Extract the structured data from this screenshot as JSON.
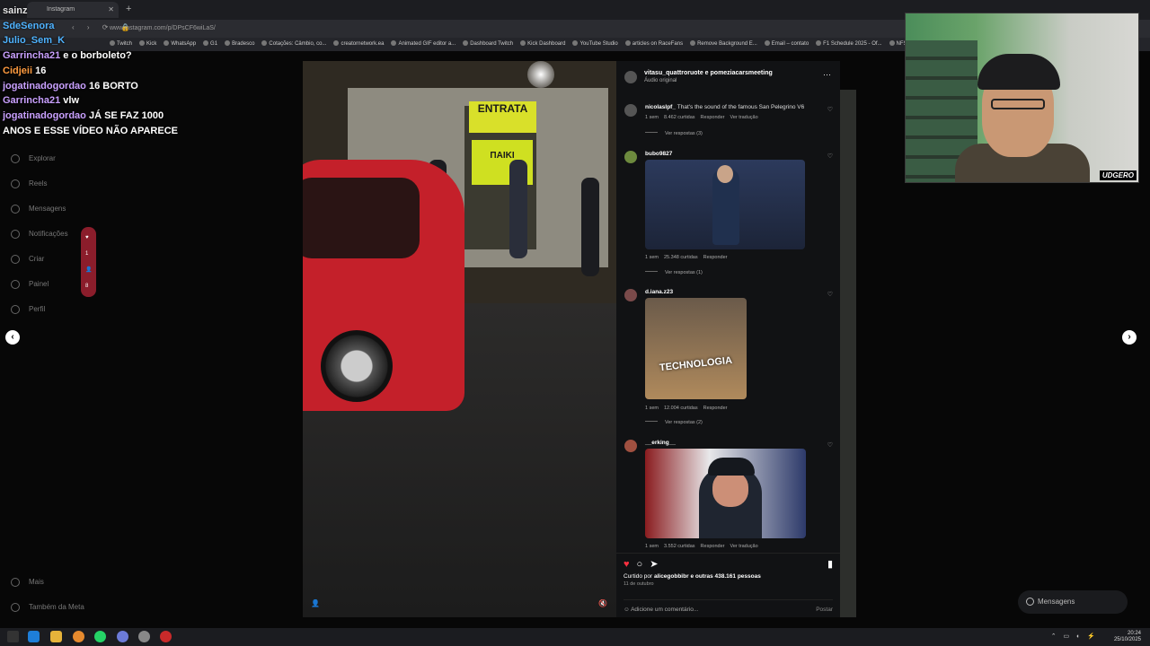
{
  "browser": {
    "tab_title": "Instagram",
    "url": "www.instagram.com/p/DPsCF6wiLaS/",
    "bookmarks": [
      "Twitch",
      "Kick",
      "WhatsApp",
      "G1",
      "Bradesco",
      "Cotações: Câmbio, co...",
      "creatornetwork.ea",
      "Animated GIF editor a...",
      "Dashboard Twitch",
      "Kick Dashboard",
      "YouTube Studio",
      "articles on RaceFans",
      "Remove Background E...",
      "Email – contato",
      "F1 Schedule 2025 - Of...",
      "NFS-e | Portal Contr..."
    ]
  },
  "chat": [
    {
      "user": "sainz",
      "text": "",
      "color": "#e6e6e6"
    },
    {
      "user": "SdeSenora",
      "text": "",
      "color": "#4fb3ff"
    },
    {
      "user": "Julio_Sem_K",
      "text": "",
      "color": "#4fb3ff"
    },
    {
      "user": "Garrincha21",
      "text": "e o borboleto?",
      "color": "#c9a0ff"
    },
    {
      "user": "Cidjeii",
      "text": "16",
      "color": "#ff9b3f"
    },
    {
      "user": "jogatinadogordao",
      "text": "16 BORTO",
      "color": "#c9a0ff"
    },
    {
      "user": "Garrincha21",
      "text": "vlw",
      "color": "#c9a0ff"
    },
    {
      "user": "jogatinadogordao",
      "text": "JÁ SE FAZ 1000",
      "color": "#c9a0ff"
    },
    {
      "user": "",
      "text": "ANOS E ESSE VÍDEO NÃO APARECE",
      "color": "#fff"
    }
  ],
  "sidenav": {
    "items": [
      {
        "label": "Explorar",
        "icon": "compass-icon"
      },
      {
        "label": "Reels",
        "icon": "reels-icon"
      },
      {
        "label": "Mensagens",
        "icon": "messenger-icon"
      },
      {
        "label": "Notificações",
        "icon": "heart-icon"
      },
      {
        "label": "Criar",
        "icon": "plus-icon"
      },
      {
        "label": "Painel",
        "icon": "dashboard-icon"
      },
      {
        "label": "Perfil",
        "icon": "profile-icon"
      }
    ],
    "notif_badge": "♥ 1  👤 8",
    "bottom": [
      {
        "label": "Mais",
        "icon": "menu-icon"
      },
      {
        "label": "Também da Meta",
        "icon": "meta-icon"
      }
    ]
  },
  "video": {
    "sign_top": "ENTRATA",
    "sign_brand": "ΠΑΙΚΙ"
  },
  "post": {
    "author": "vitasu_quattroruote e pomeziacarsmeeting",
    "audio": "Áudio original",
    "comments": [
      {
        "user": "nicolaslpf_",
        "text": "That's the sound of the famous San Pelegrino V6",
        "time": "1 sem",
        "likes": "8.462 curtidas",
        "reply": "Responder",
        "translate": "Ver tradução",
        "replies": "Ver respostas (3)"
      },
      {
        "user": "bubo9827",
        "text": "",
        "time": "1 sem",
        "likes": "25.348 curtidas",
        "reply": "Responder",
        "translate": "",
        "replies": "Ver respostas (1)"
      },
      {
        "user": "d.iana.z23",
        "text": "",
        "time": "1 sem",
        "likes": "12.004 curtidas",
        "reply": "Responder",
        "translate": "",
        "replies": "Ver respostas (2)",
        "gif_text": "TECHNOLOGIA"
      },
      {
        "user": "__erking__",
        "text": "",
        "time": "1 sem",
        "likes": "3.552 curtidas",
        "reply": "Responder",
        "translate": "Ver tradução",
        "replies": ""
      }
    ],
    "liked_by_prefix": "Curtido por",
    "liked_by_user": "alicegobbibr",
    "liked_by_rest": "e outras 438.161 pessoas",
    "date": "11 de outubro",
    "comment_placeholder": "Adicione um comentário...",
    "post_button": "Postar"
  },
  "webcam": {
    "logo": "UDGERO"
  },
  "messages_button": "Mensagens",
  "taskbar": {
    "time": "20:24",
    "date": "25/10/2025"
  },
  "colors": {
    "like_red": "#ff3040",
    "ig_bg": "#111214"
  }
}
